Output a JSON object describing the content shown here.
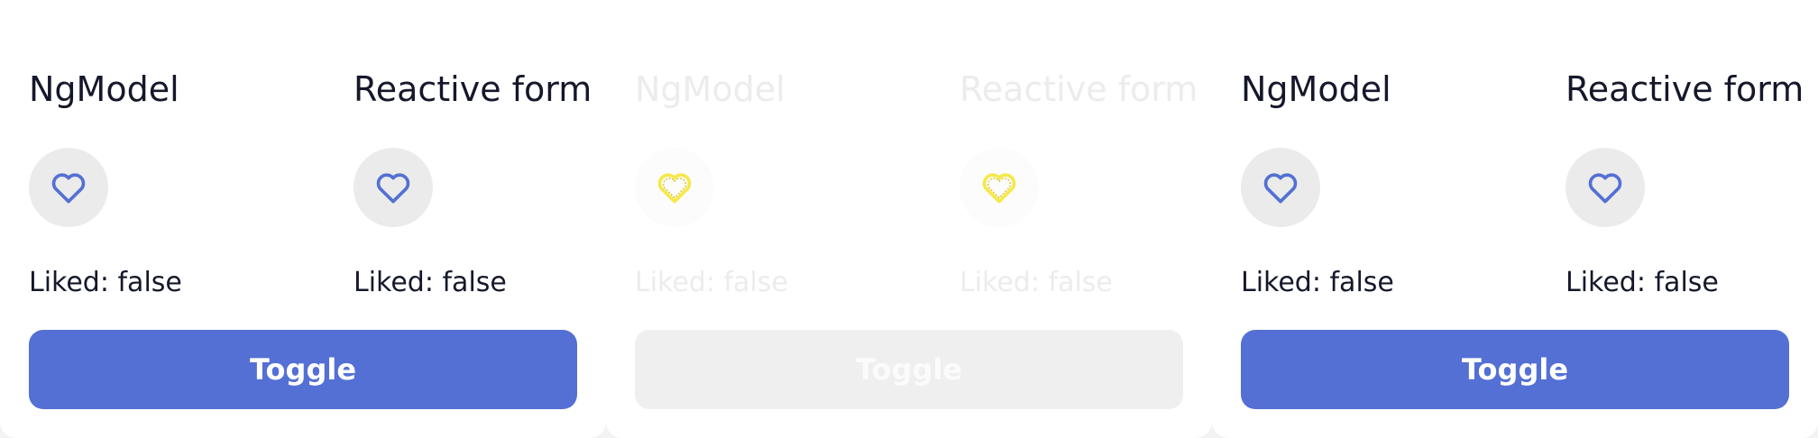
{
  "colors": {
    "accent": "#5470d4",
    "heart_active": "#5470d4",
    "heart_disabled": "#f5e94a",
    "text": "#15182b",
    "text_disabled": "#ececec"
  },
  "panels": [
    {
      "state": "enabled",
      "ngmodel": {
        "title": "NgModel",
        "liked": "Liked: false",
        "icon": "heart-outline-icon"
      },
      "reactive": {
        "title": "Reactive form",
        "liked": "Liked: false",
        "icon": "heart-outline-icon"
      },
      "toggle_label": "Toggle"
    },
    {
      "state": "disabled",
      "ngmodel": {
        "title": "NgModel",
        "liked": "Liked: false",
        "icon": "heart-outline-icon"
      },
      "reactive": {
        "title": "Reactive form",
        "liked": "Liked: false",
        "icon": "heart-outline-icon"
      },
      "toggle_label": "Toggle"
    },
    {
      "state": "enabled",
      "ngmodel": {
        "title": "NgModel",
        "liked": "Liked: false",
        "icon": "heart-outline-icon"
      },
      "reactive": {
        "title": "Reactive form",
        "liked": "Liked: false",
        "icon": "heart-outline-icon"
      },
      "toggle_label": "Toggle"
    }
  ]
}
